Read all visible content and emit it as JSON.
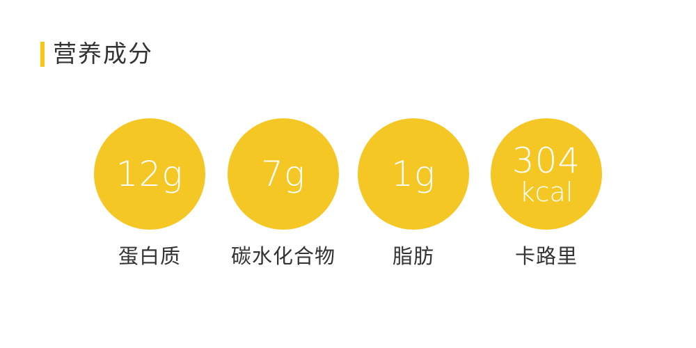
{
  "header": {
    "title": "营养成分"
  },
  "nutrients": [
    {
      "value": "12g",
      "label": "蛋白质"
    },
    {
      "value": "7g",
      "label": "碳水化合物"
    },
    {
      "value": "1g",
      "label": "脂肪"
    },
    {
      "value": "304",
      "unit": "kcal",
      "label": "卡路里"
    }
  ],
  "colors": {
    "accent": "#f5c718",
    "circle": "#f5c724",
    "text": "#333333"
  }
}
